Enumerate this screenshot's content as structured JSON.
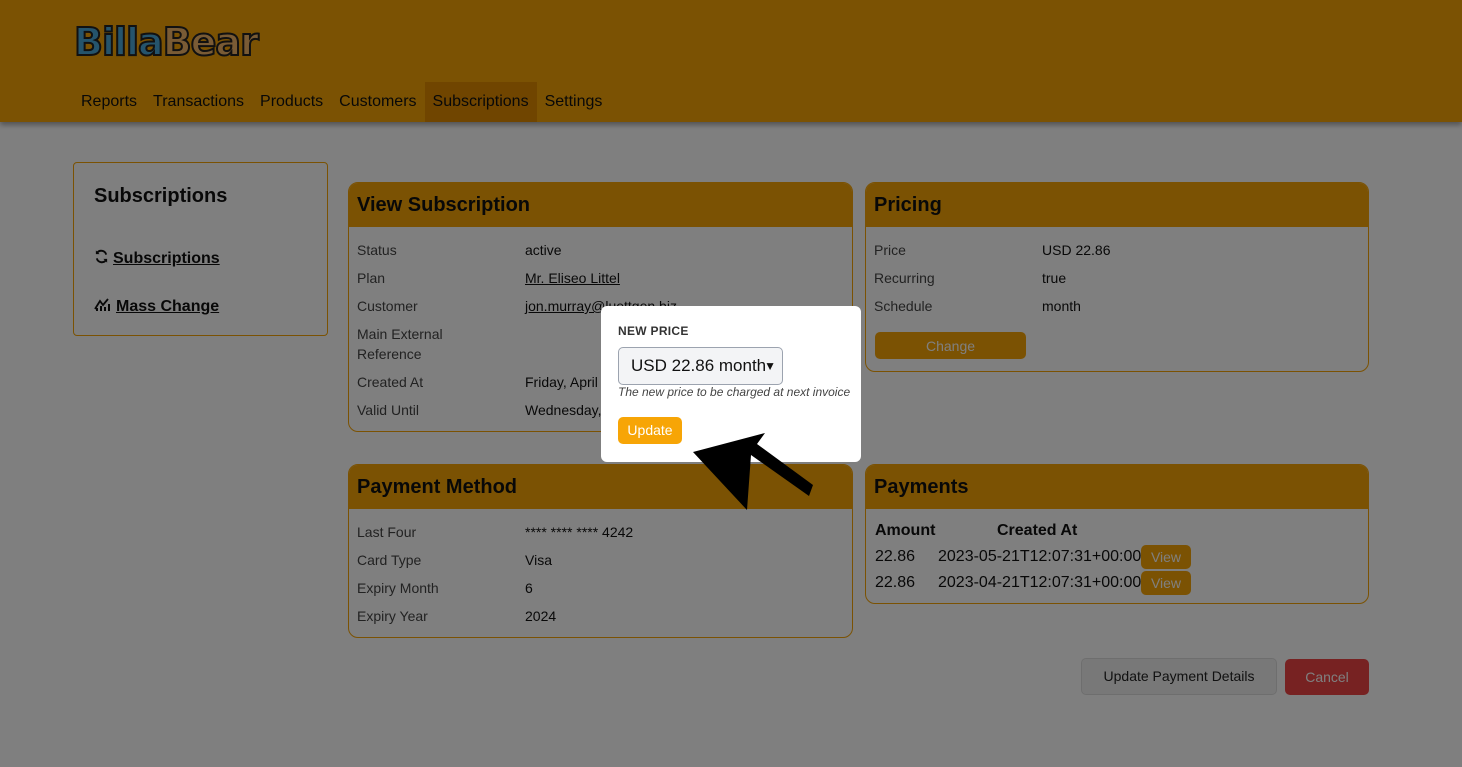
{
  "logo": {
    "part1": "Billa",
    "part2": "Bear"
  },
  "nav": [
    {
      "label": "Reports"
    },
    {
      "label": "Transactions"
    },
    {
      "label": "Products"
    },
    {
      "label": "Customers"
    },
    {
      "label": "Subscriptions"
    },
    {
      "label": "Settings"
    }
  ],
  "sidebar": {
    "title": "Subscriptions",
    "links": [
      {
        "label": "Subscriptions",
        "icon": "refresh-icon"
      },
      {
        "label": "Mass Change",
        "icon": "chart-icon"
      }
    ]
  },
  "view_subscription": {
    "title": "View Subscription",
    "rows": [
      {
        "label": "Status",
        "value": "active"
      },
      {
        "label": "Plan",
        "value": "Mr. Eliseo Littel"
      },
      {
        "label": "Customer",
        "value": "jon.murray@luettgen.biz"
      },
      {
        "label": "Main External Reference",
        "value": ""
      },
      {
        "label": "Created At",
        "value": "Friday, April"
      },
      {
        "label": "Valid Until",
        "value": "Wednesday,"
      }
    ]
  },
  "pricing": {
    "title": "Pricing",
    "rows": [
      {
        "label": "Price",
        "value": "USD 22.86"
      },
      {
        "label": "Recurring",
        "value": "true"
      },
      {
        "label": "Schedule",
        "value": "month"
      }
    ],
    "change_label": "Change"
  },
  "payment_method": {
    "title": "Payment Method",
    "rows": [
      {
        "label": "Last Four",
        "value": "**** **** **** 4242"
      },
      {
        "label": "Card Type",
        "value": "Visa"
      },
      {
        "label": "Expiry Month",
        "value": "6"
      },
      {
        "label": "Expiry Year",
        "value": "2024"
      }
    ]
  },
  "payments": {
    "title": "Payments",
    "headers": [
      "Amount",
      "Created At"
    ],
    "rows": [
      {
        "amount": "22.86",
        "created_at": "2023-05-21T12:07:31+00:00",
        "action": "View"
      },
      {
        "amount": "22.86",
        "created_at": "2023-04-21T12:07:31+00:00",
        "action": "View"
      }
    ]
  },
  "actions": {
    "update_payment": "Update Payment Details",
    "cancel": "Cancel"
  },
  "modal": {
    "label": "NEW PRICE",
    "selected": "USD 22.86 month",
    "hint": "The new price to be charged at next invoice",
    "update_label": "Update"
  },
  "colors": {
    "accent": "#f7a506",
    "danger": "#ef4444",
    "link": "#1d4ed8"
  }
}
